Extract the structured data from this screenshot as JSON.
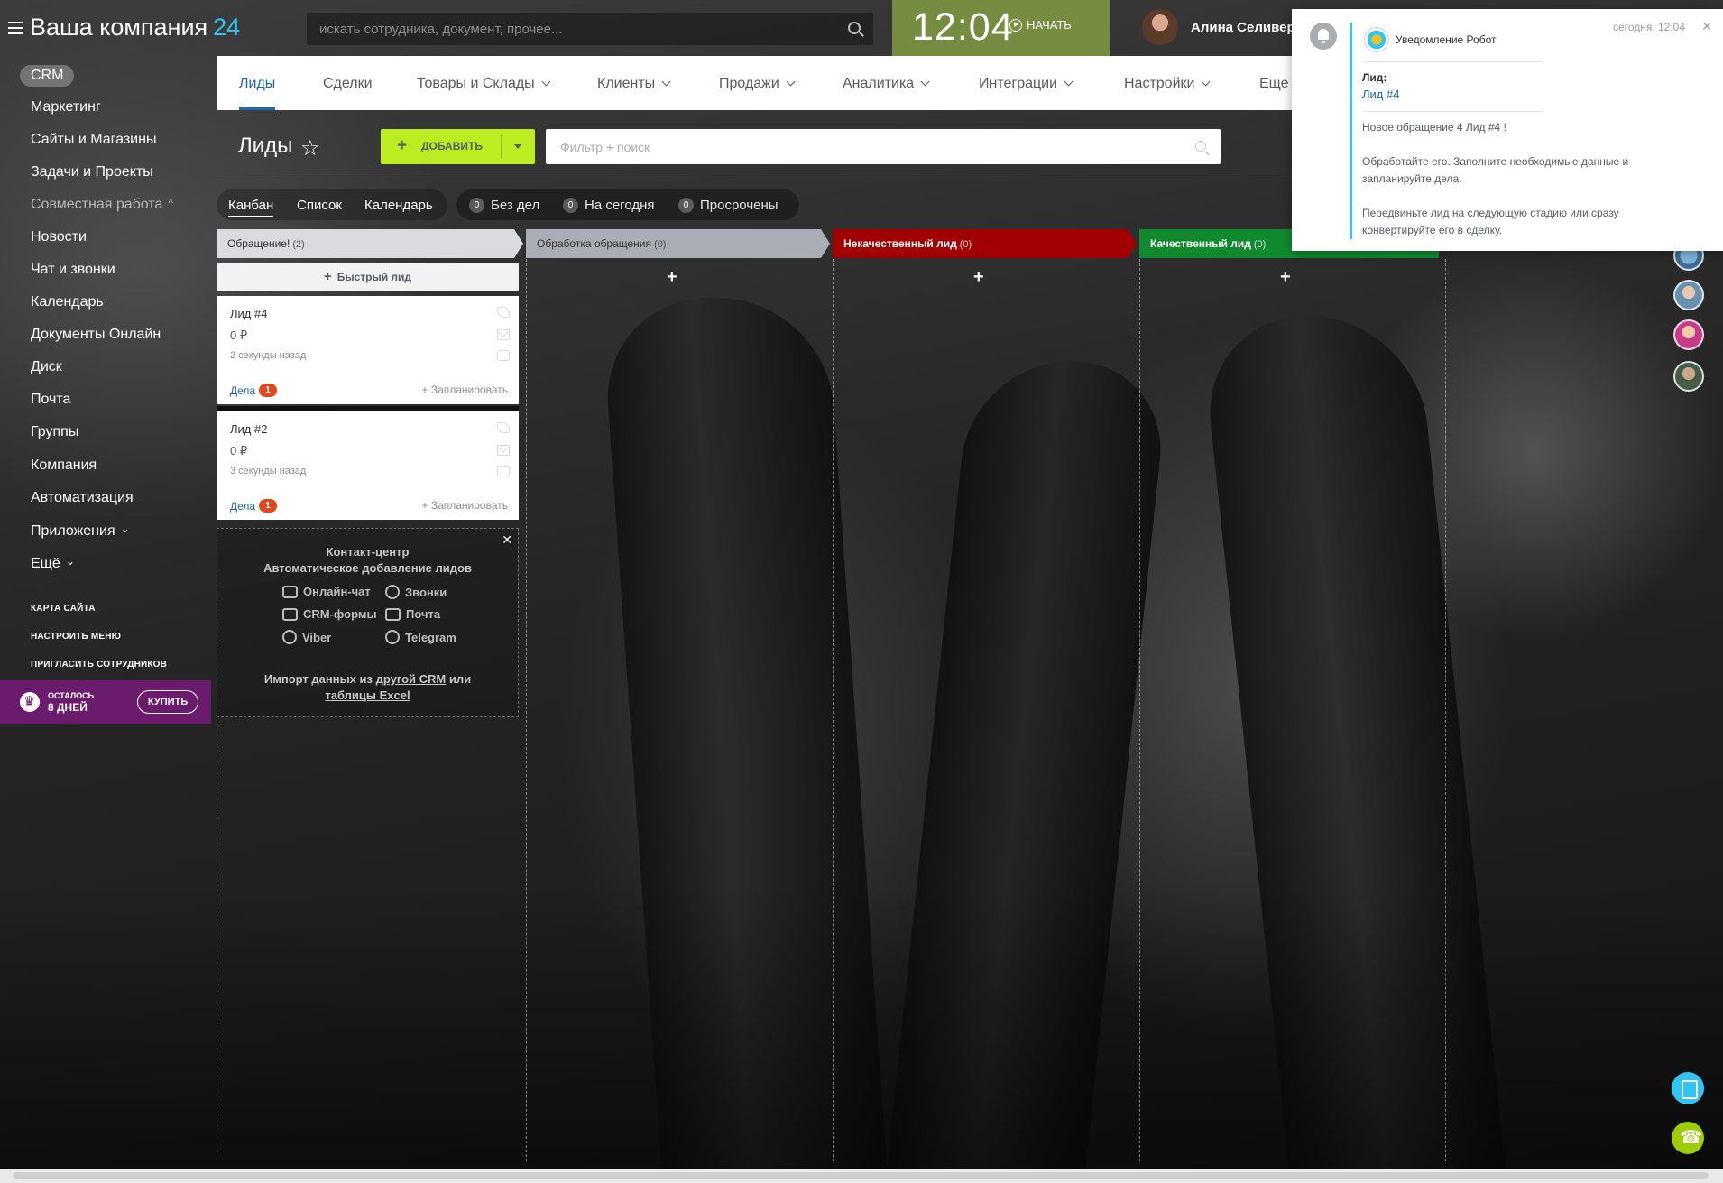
{
  "header": {
    "logo_text": "Ваша компания",
    "logo_num": "24",
    "search_placeholder": "искать сотрудника, документ, прочее...",
    "clock": "12:04",
    "start_label": "НАЧАТЬ",
    "user_name": "Алина Селивер..."
  },
  "sidebar": {
    "crm": "CRM",
    "items": [
      "Маркетинг",
      "Сайты и Магазины",
      "Задачи и Проекты",
      "Совместная работа",
      "Новости",
      "Чат и звонки",
      "Календарь",
      "Документы Онлайн",
      "Диск",
      "Почта",
      "Группы",
      "Компания",
      "Автоматизация",
      "Приложения",
      "Ещё"
    ],
    "links": [
      "КАРТА САЙТА",
      "НАСТРОИТЬ МЕНЮ",
      "ПРИГЛАСИТЬ СОТРУДНИКОВ"
    ],
    "trial_left": "ОСТАЛОСЬ",
    "trial_days": "8 ДНЕЙ",
    "buy": "КУПИТЬ"
  },
  "topnav": [
    "Лиды",
    "Сделки",
    "Товары и Склады",
    "Клиенты",
    "Продажи",
    "Аналитика",
    "Интеграции",
    "Настройки",
    "Еще"
  ],
  "toolbar": {
    "title": "Лиды",
    "add_label": "ДОБАВИТЬ",
    "filter_placeholder": "Фильтр + поиск"
  },
  "views": [
    "Канбан",
    "Список",
    "Календарь"
  ],
  "counters": [
    {
      "value": "0",
      "label": "Без дел"
    },
    {
      "value": "0",
      "label": "На сегодня"
    },
    {
      "value": "0",
      "label": "Просрочены"
    }
  ],
  "columns": [
    {
      "title": "Обращение!",
      "count": "(2)",
      "color": "#d9dbde"
    },
    {
      "title": "Обработка обращения",
      "count": "(0)",
      "color": "#a9adb5"
    },
    {
      "title": "Некачественный лид",
      "count": "(0)",
      "color": "#a00000"
    },
    {
      "title": "Качественный лид",
      "count": "(0)",
      "color": "#118a2f"
    }
  ],
  "quick_lead": "Быстрый лид",
  "cards": [
    {
      "title": "Лид #4",
      "sum": "0 ₽",
      "time": "2 секунды назад",
      "deals": "Дела",
      "deals_count": "1",
      "plan": "+ Запланировать"
    },
    {
      "title": "Лид #2",
      "sum": "0 ₽",
      "time": "3 секунды назад",
      "deals": "Дела",
      "deals_count": "1",
      "plan": "+ Запланировать"
    }
  ],
  "contact_center": {
    "title1": "Контакт-центр",
    "title2": "Автоматическое добавление лидов",
    "items": [
      "Онлайн-чат",
      "Звонки",
      "CRM-формы",
      "Почта",
      "Viber",
      "Telegram"
    ],
    "import_a": "Импорт данных из ",
    "import_b": "другой CRM",
    "import_c": " или",
    "import_d": "таблицы Excel"
  },
  "notification": {
    "author": "Уведомление Робот",
    "time": "сегодня, 12:04",
    "label": "Лид:",
    "link": "Лид #4",
    "p1": "Новое обращение 4 Лид #4 !",
    "p2": "Обработайте его. Заполните необходимые данные и запланируйте дела.",
    "p3": "Передвиньте лид на следующую стадию или сразу конвертируйте его в сделку."
  }
}
